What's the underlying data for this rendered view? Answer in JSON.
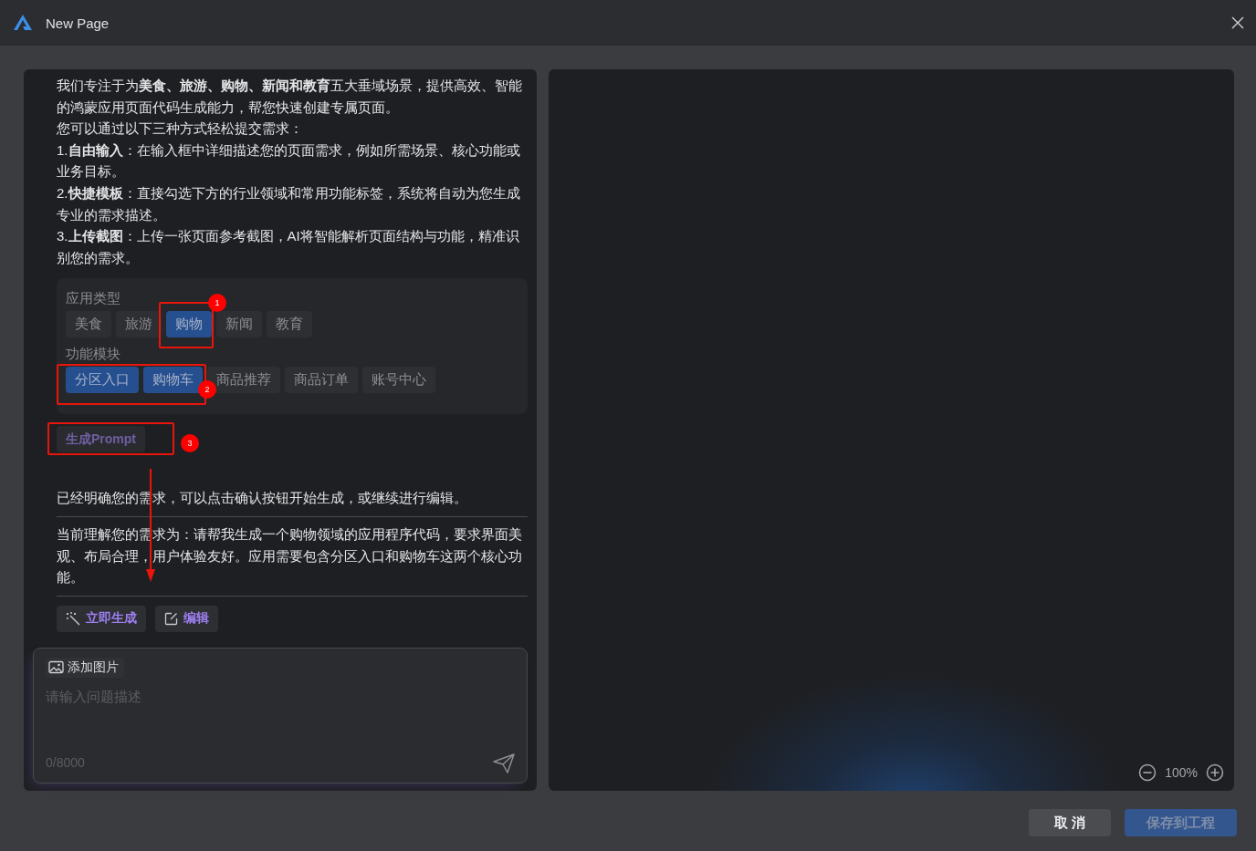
{
  "window": {
    "title": "New Page"
  },
  "intro": [
    "我们专注于为**美食、旅游、购物、新闻和教育**五大垂域场景，提供高效、智能的鸿蒙应用页面代码生成能力，帮您快速创建专属页面。",
    "您可以通过以下三种方式轻松提交需求：",
    "1.**自由输入**：在输入框中详细描述您的页面需求，例如所需场景、核心功能或业务目标。",
    "2.**快捷模板**：直接勾选下方的行业领域和常用功能标签，系统将自动为您生成专业的需求描述。",
    "3.**上传截图**：上传一张页面参考截图，AI将智能解析页面结构与功能，精准识别您的需求。"
  ],
  "tag_groups": [
    {
      "label": "应用类型",
      "tags": [
        {
          "label": "美食",
          "selected": false
        },
        {
          "label": "旅游",
          "selected": false
        },
        {
          "label": "购物",
          "selected": true
        },
        {
          "label": "新闻",
          "selected": false
        },
        {
          "label": "教育",
          "selected": false
        }
      ]
    },
    {
      "label": "功能模块",
      "tags": [
        {
          "label": "分区入口",
          "selected": true
        },
        {
          "label": "购物车",
          "selected": true
        },
        {
          "label": "商品推荐",
          "selected": false
        },
        {
          "label": "商品订单",
          "selected": false
        },
        {
          "label": "账号中心",
          "selected": false
        }
      ]
    }
  ],
  "generate_prompt_button": "生成Prompt",
  "confirm_text": "已经明确您的需求，可以点击确认按钮开始生成，或继续进行编辑。",
  "understanding_text": "当前理解您的需求为：请帮我生成一个购物领域的应用程序代码，要求界面美观、布局合理，用户体验友好。应用需要包含分区入口和购物车这两个核心功能。",
  "actions": [
    {
      "kind": "generate",
      "label": "立即生成"
    },
    {
      "kind": "edit",
      "label": "编辑"
    }
  ],
  "input": {
    "add_image": "添加图片",
    "placeholder": "请输入问题描述",
    "counter": "0/8000"
  },
  "preview": {
    "zoom": "100%"
  },
  "footer": {
    "cancel": "取 消",
    "save": {
      "label": "保存到工程",
      "disabled": true
    }
  },
  "annotations": {
    "arrow": true,
    "markers": [
      {
        "label": "1"
      },
      {
        "label": "2"
      },
      {
        "label": "3"
      }
    ]
  }
}
